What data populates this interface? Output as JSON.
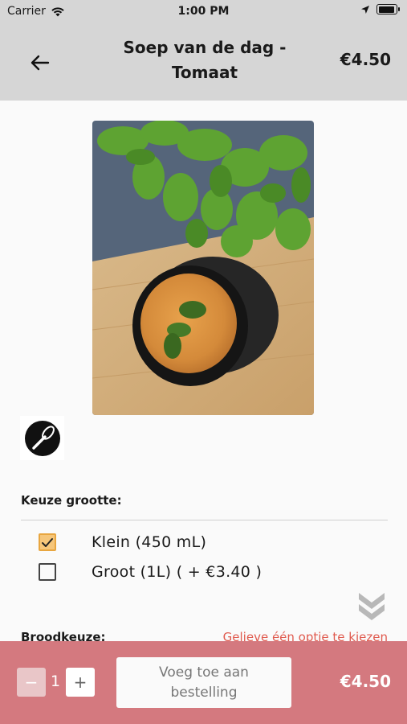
{
  "status_bar": {
    "carrier": "Carrier",
    "time": "1:00 PM",
    "battery_level": 0.95
  },
  "header": {
    "title": "Soep van de dag - Tomaat",
    "price": "€4.50",
    "back_icon": "arrow-left-icon"
  },
  "product": {
    "image": "tomato-soup-with-basil-photo",
    "allergen_icon": "mixer-whisk-icon"
  },
  "size_section": {
    "title": "Keuze grootte:",
    "options": [
      {
        "label": "Klein (450 mL)",
        "checked": true
      },
      {
        "label": "Groot (1L) ( + €3.40 )",
        "checked": false
      }
    ]
  },
  "bread_section": {
    "title": "Broodkeuze:",
    "warning": "Gelieve één optie te kiezen"
  },
  "order_bar": {
    "quantity": "1",
    "minus_label": "−",
    "plus_label": "+",
    "add_label": "Voeg toe aan bestelling",
    "total": "€4.50"
  },
  "colors": {
    "header_bg": "#d6d6d6",
    "checkbox_checked": "#f6c67a",
    "bottom_bar": "#d4797f",
    "warning": "#e05a4e"
  }
}
